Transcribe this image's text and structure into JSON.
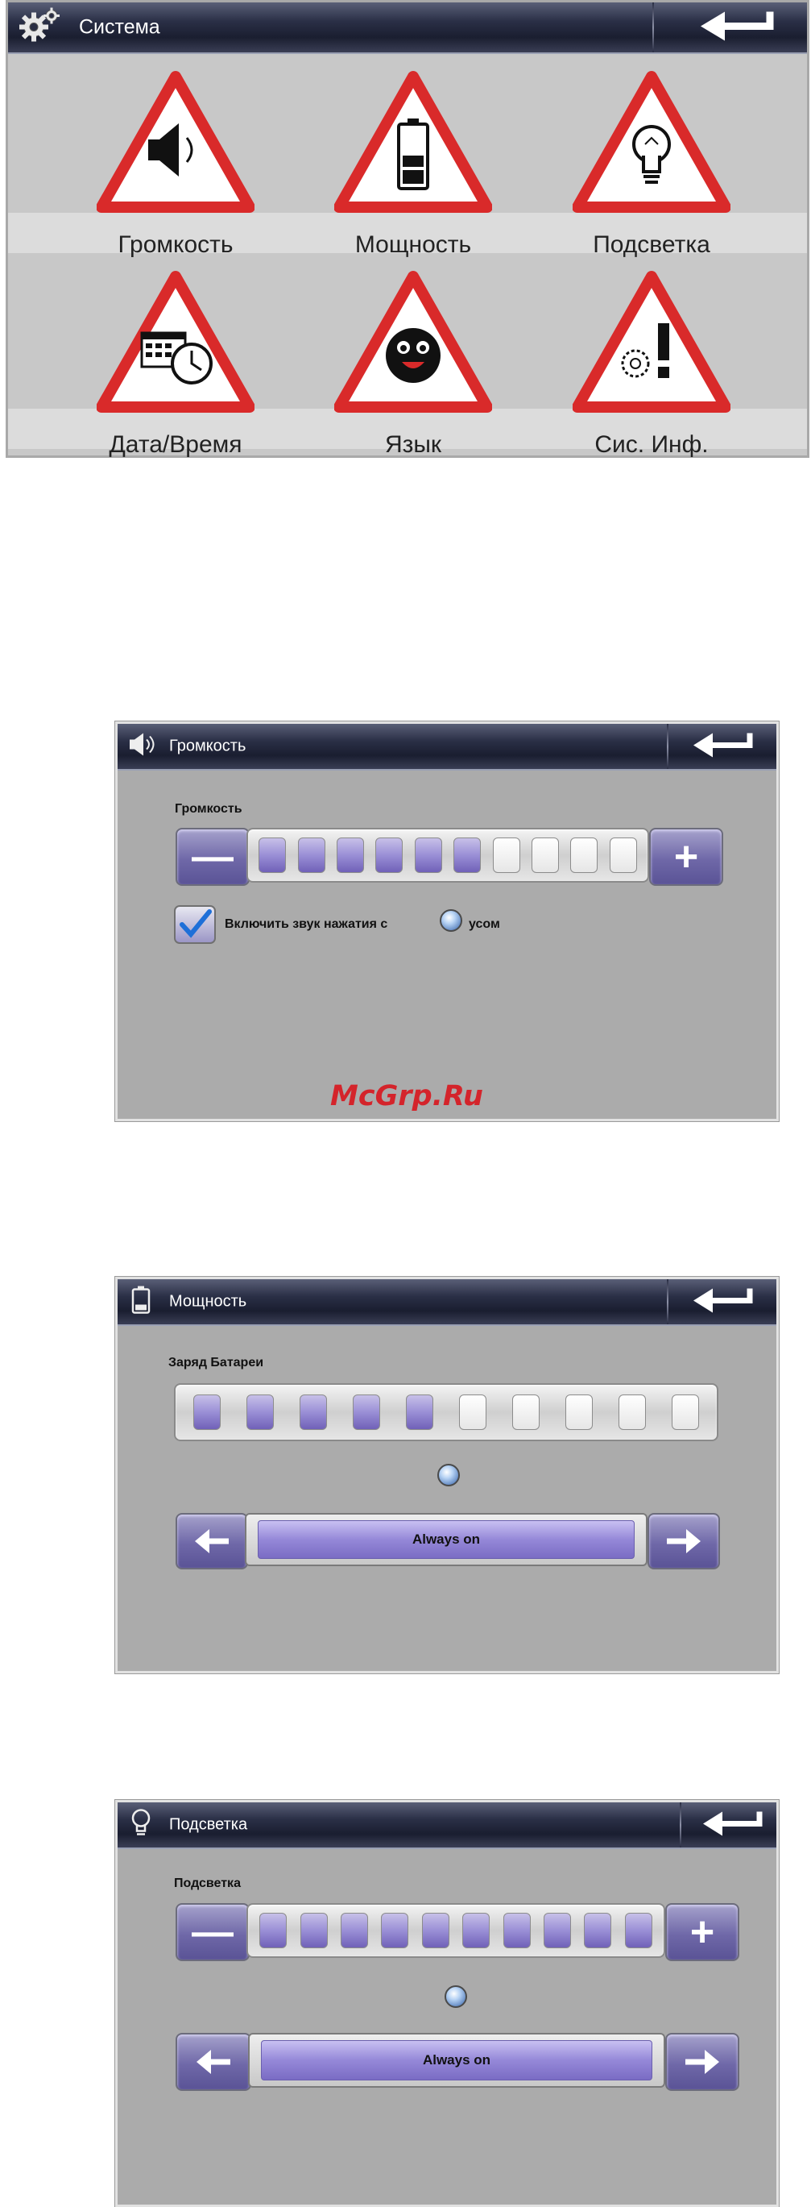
{
  "system": {
    "title": "Система",
    "items": [
      {
        "label": "Громкость",
        "icon": "speaker-icon"
      },
      {
        "label": "Мощность",
        "icon": "battery-icon"
      },
      {
        "label": "Подсветка",
        "icon": "lightbulb-icon"
      },
      {
        "label": "Дата/Время",
        "icon": "calendar-clock-icon"
      },
      {
        "label": "Язык",
        "icon": "smiley-face-icon"
      },
      {
        "label": "Сис. Инф.",
        "icon": "gear-exclamation-icon"
      }
    ]
  },
  "volume": {
    "title": "Громкость",
    "label": "Громкость",
    "level": 0.6,
    "segments_total": 10,
    "segments_on": 6,
    "checkbox_label": "Включить звук нажатия с",
    "checkbox_label_tail": "усом",
    "checkbox_checked": true
  },
  "power": {
    "title": "Мощность",
    "label": "Заряд Батареи",
    "segments_total": 10,
    "segments_on": 5,
    "selector_value": "Always on"
  },
  "backlight": {
    "title": "Подсветка",
    "label": "Подсветка",
    "segments_total": 10,
    "segments_on": 10,
    "selector_value": "Always on"
  },
  "watermark": "McGrp.Ru",
  "colors": {
    "triangle_red": "#d92a2a",
    "accent_purple": "#7061b8",
    "titlebar_dark": "#1a1e30",
    "panel_gray": "#ababab"
  }
}
